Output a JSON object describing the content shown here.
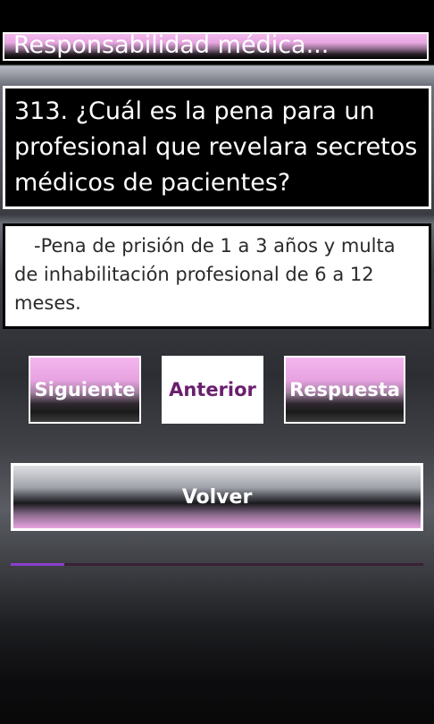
{
  "header": {
    "title": "Responsabilidad médica..."
  },
  "question": {
    "text": "313. ¿Cuál es la pena para un profesional que revelara secretos médicos de pacientes?"
  },
  "answer": {
    "text": "-Pena de prisión de 1 a 3 años y multa de inhabilitación profesional de 6 a 12 meses."
  },
  "buttons": {
    "next_label": "Siguiente",
    "previous_label": "Anterior",
    "answer_label": "Respuesta",
    "back_label": "Volver"
  },
  "progress": {
    "fraction": 0.13,
    "fill_color": "#8a3fd0",
    "track_color": "#3b2035"
  },
  "colors": {
    "accent_pink": "#e7a3e1",
    "previous_text": "#6a1f6f"
  }
}
